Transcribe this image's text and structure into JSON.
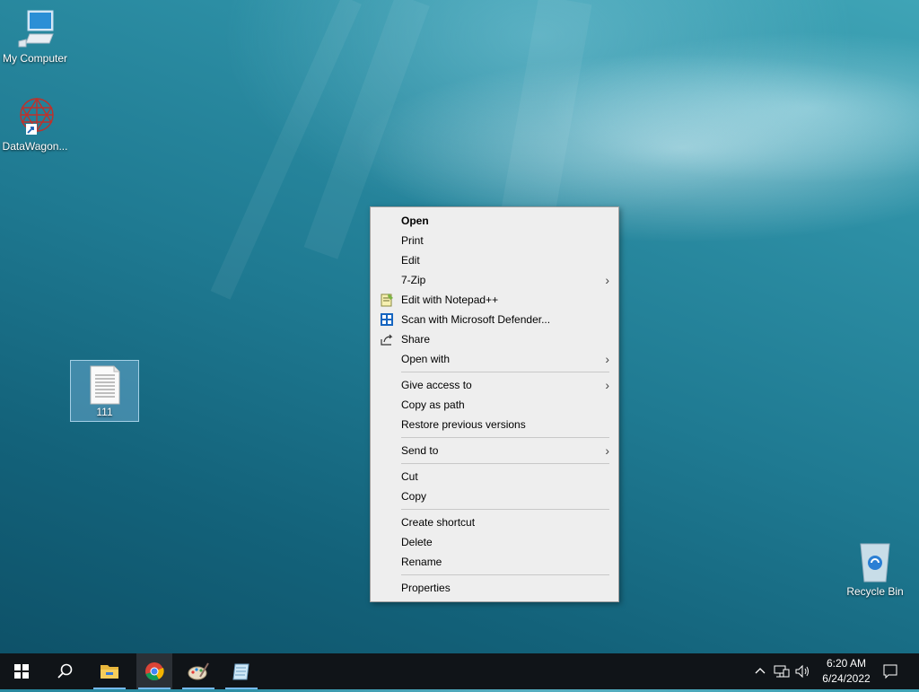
{
  "desktop": {
    "icons": [
      {
        "label": "My Computer"
      },
      {
        "label": "DataWagon..."
      },
      {
        "label": "111"
      },
      {
        "label": "Recycle Bin"
      }
    ]
  },
  "context_menu": {
    "items": [
      {
        "label": "Open",
        "bold": true
      },
      {
        "label": "Print"
      },
      {
        "label": "Edit"
      },
      {
        "label": "7-Zip",
        "submenu": true
      },
      {
        "label": "Edit with Notepad++",
        "icon": "notepad-plus-plus-icon"
      },
      {
        "label": "Scan with Microsoft Defender...",
        "icon": "defender-shield-icon"
      },
      {
        "label": "Share",
        "icon": "share-icon"
      },
      {
        "label": "Open with",
        "submenu": true
      },
      {
        "label": "Give access to",
        "submenu": true
      },
      {
        "label": "Copy as path"
      },
      {
        "label": "Restore previous versions"
      },
      {
        "label": "Send to",
        "submenu": true
      },
      {
        "label": "Cut"
      },
      {
        "label": "Copy"
      },
      {
        "label": "Create shortcut"
      },
      {
        "label": "Delete"
      },
      {
        "label": "Rename"
      },
      {
        "label": "Properties"
      }
    ],
    "submenu_arrow": ">"
  },
  "taskbar": {
    "apps": [
      "start-icon",
      "search-icon",
      "file-explorer-icon",
      "chrome-icon",
      "paint-icon",
      "notepad-icon"
    ],
    "active_app": "chrome-icon",
    "time": "6:20 AM",
    "date": "6/24/2022",
    "tray_chevron": "^"
  },
  "colors": {
    "taskbar": "#101418",
    "menu_bg": "#eeeeee",
    "selection": "#76b9ed"
  }
}
